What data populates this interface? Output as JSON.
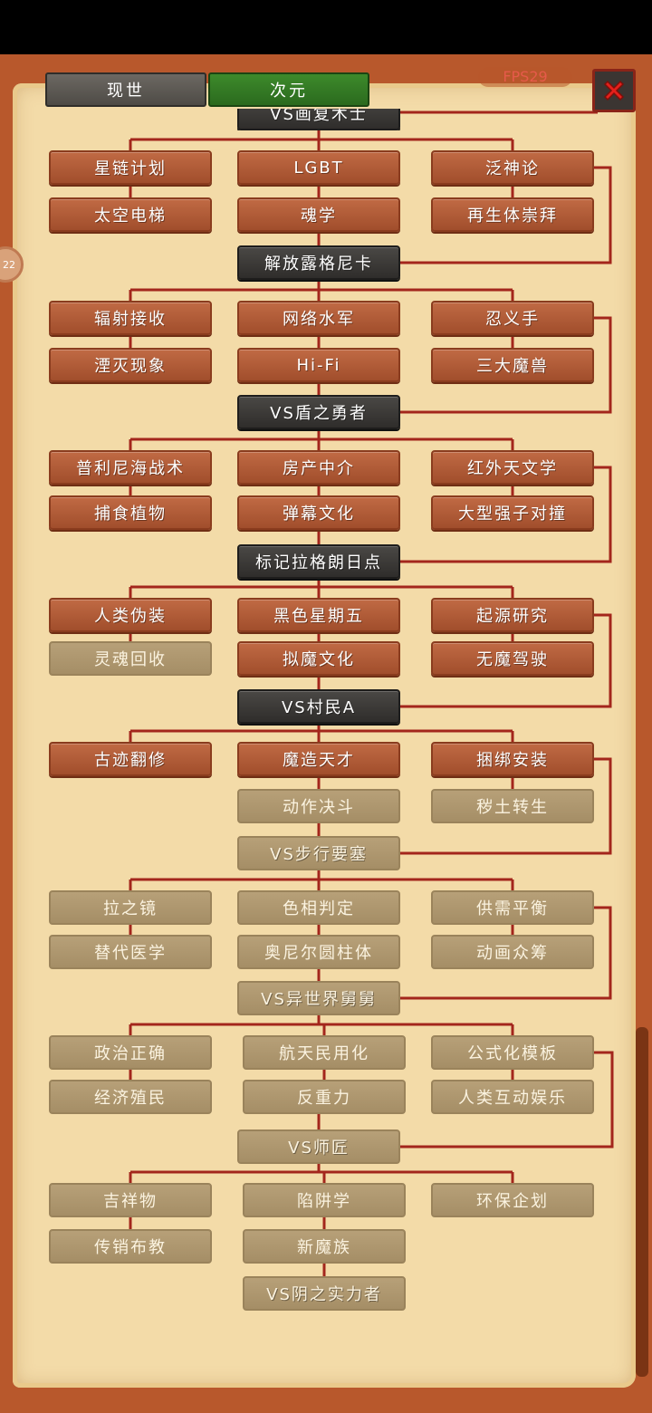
{
  "tabs": [
    {
      "label": "现世"
    },
    {
      "label": "次元"
    }
  ],
  "fps": "FPS29",
  "side_badge": "22",
  "colors": {
    "link": "#a3261c",
    "unlocked": "#a8532f",
    "locked": "#ab936b",
    "boss": "#3b3937",
    "active_tab": "#2f7222"
  },
  "top_partial_boss": "VS画复术士",
  "groups": [
    {
      "rows": [
        [
          "星链计划",
          "LGBT",
          "泛神论"
        ],
        [
          "太空电梯",
          "魂学",
          "再生体崇拜"
        ]
      ],
      "boss": "解放露格尼卡",
      "status": [
        [
          "unlocked",
          "unlocked",
          "unlocked"
        ],
        [
          "unlocked",
          "unlocked",
          "unlocked"
        ]
      ],
      "boss_status": "boss"
    },
    {
      "rows": [
        [
          "辐射接收",
          "网络水军",
          "忍义手"
        ],
        [
          "湮灭现象",
          "Hi-Fi",
          "三大魔兽"
        ]
      ],
      "boss": "VS盾之勇者",
      "status": [
        [
          "unlocked",
          "unlocked",
          "unlocked"
        ],
        [
          "unlocked",
          "unlocked",
          "unlocked"
        ]
      ],
      "boss_status": "boss"
    },
    {
      "rows": [
        [
          "普利尼海战术",
          "房产中介",
          "红外天文学"
        ],
        [
          "捕食植物",
          "弹幕文化",
          "大型强子对撞"
        ]
      ],
      "boss": "标记拉格朗日点",
      "status": [
        [
          "unlocked",
          "unlocked",
          "unlocked"
        ],
        [
          "unlocked",
          "unlocked",
          "unlocked"
        ]
      ],
      "boss_status": "boss"
    },
    {
      "rows": [
        [
          "人类伪装",
          "黑色星期五",
          "起源研究"
        ],
        [
          "灵魂回收",
          "拟魔文化",
          "无魔驾驶"
        ]
      ],
      "boss": "VS村民A",
      "status": [
        [
          "unlocked",
          "unlocked",
          "unlocked"
        ],
        [
          "locked",
          "unlocked",
          "unlocked"
        ]
      ],
      "boss_status": "boss"
    },
    {
      "rows": [
        [
          "古迹翻修",
          "魔造天才",
          "捆绑安装"
        ],
        [
          "",
          "动作决斗",
          "秽土转生"
        ]
      ],
      "boss": "VS步行要塞",
      "status": [
        [
          "unlocked",
          "unlocked",
          "unlocked"
        ],
        [
          "none",
          "locked",
          "locked"
        ]
      ],
      "boss_status": "boss-locked"
    },
    {
      "rows": [
        [
          "拉之镜",
          "色相判定",
          "供需平衡"
        ],
        [
          "替代医学",
          "奥尼尔圆柱体",
          "动画众筹"
        ]
      ],
      "boss": "VS异世界舅舅",
      "status": [
        [
          "locked",
          "locked",
          "locked"
        ],
        [
          "locked",
          "locked",
          "locked"
        ]
      ],
      "boss_status": "boss-locked"
    },
    {
      "rows": [
        [
          "政治正确",
          "航天民用化",
          "公式化模板"
        ],
        [
          "经济殖民",
          "反重力",
          "人类互动娱乐"
        ]
      ],
      "boss": "VS师匠",
      "status": [
        [
          "locked",
          "locked",
          "locked"
        ],
        [
          "locked",
          "locked",
          "locked"
        ]
      ],
      "boss_status": "boss-locked"
    },
    {
      "rows": [
        [
          "吉祥物",
          "陷阱学",
          "环保企划"
        ],
        [
          "传销布教",
          "新魔族",
          ""
        ]
      ],
      "boss": "VS阴之实力者",
      "status": [
        [
          "locked",
          "locked",
          "locked"
        ],
        [
          "locked",
          "locked",
          "none"
        ]
      ],
      "boss_status": "boss-locked"
    }
  ]
}
